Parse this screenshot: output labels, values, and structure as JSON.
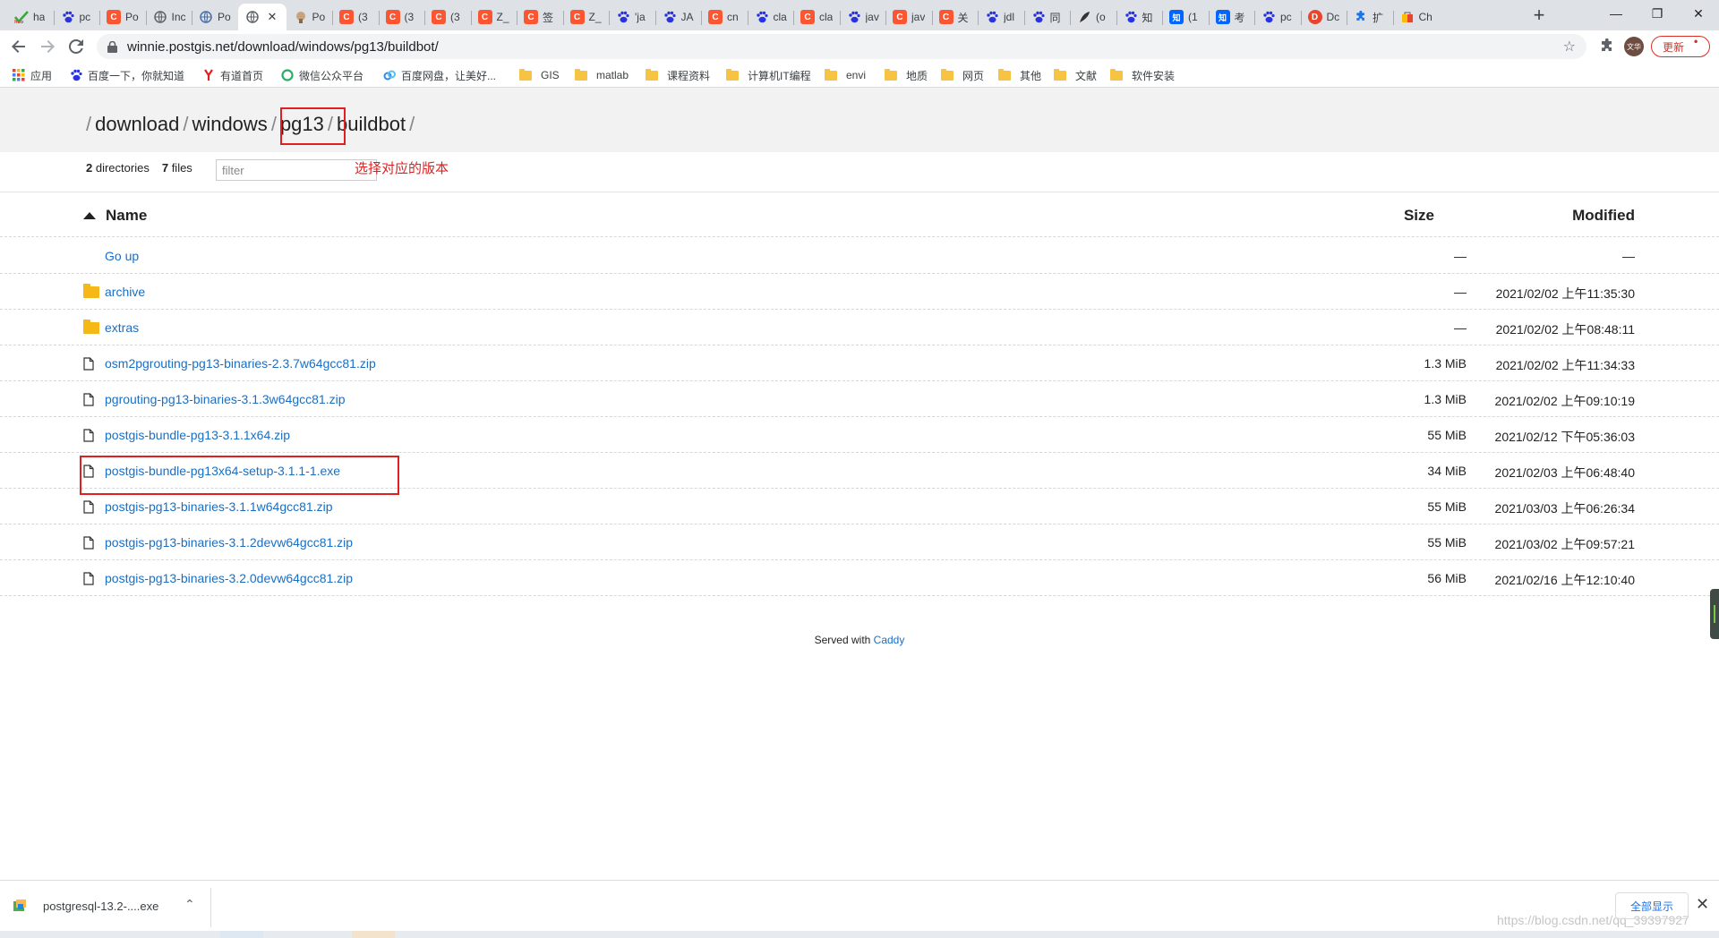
{
  "browser": {
    "tabs": [
      {
        "label": "ha",
        "favicon": "hao123-icon",
        "color": "#3aa83a"
      },
      {
        "label": "pc",
        "favicon": "baidu-paw-icon",
        "color": "#2932e1"
      },
      {
        "label": "Po",
        "favicon": "csdn-icon",
        "color": "#fc5531"
      },
      {
        "label": "Inc",
        "favicon": "globe-icon",
        "color": "#5f6368"
      },
      {
        "label": "Po",
        "favicon": "globe-icon",
        "color": "#4a6fa5"
      },
      {
        "label": "",
        "favicon": "globe-icon",
        "color": "#5f6368",
        "active": true,
        "close": "✕"
      },
      {
        "label": "Po",
        "favicon": "elephant-icon",
        "color": "#b07b4f"
      },
      {
        "label": "(3",
        "favicon": "csdn-icon",
        "color": "#fc5531"
      },
      {
        "label": "(3",
        "favicon": "csdn-icon",
        "color": "#fc5531"
      },
      {
        "label": "(3",
        "favicon": "csdn-icon",
        "color": "#fc5531"
      },
      {
        "label": "Z_",
        "favicon": "csdn-icon",
        "color": "#fc5531"
      },
      {
        "label": "签",
        "favicon": "csdn-icon",
        "color": "#fc5531"
      },
      {
        "label": "Z_",
        "favicon": "csdn-icon",
        "color": "#fc5531"
      },
      {
        "label": "'ja",
        "favicon": "baidu-paw-icon",
        "color": "#2932e1"
      },
      {
        "label": "JA",
        "favicon": "baidu-paw-icon",
        "color": "#2932e1"
      },
      {
        "label": "cn",
        "favicon": "csdn-icon",
        "color": "#fc5531"
      },
      {
        "label": "cla",
        "favicon": "baidu-paw-icon",
        "color": "#2932e1"
      },
      {
        "label": "cla",
        "favicon": "csdn-icon",
        "color": "#fc5531"
      },
      {
        "label": "jav",
        "favicon": "baidu-paw-icon",
        "color": "#2932e1"
      },
      {
        "label": "jav",
        "favicon": "csdn-icon",
        "color": "#fc5531"
      },
      {
        "label": "关",
        "favicon": "csdn-icon",
        "color": "#fc5531"
      },
      {
        "label": "jdl",
        "favicon": "baidu-paw-icon",
        "color": "#2932e1"
      },
      {
        "label": "同",
        "favicon": "baidu-paw-icon",
        "color": "#2932e1"
      },
      {
        "label": "(o",
        "favicon": "feather-icon",
        "color": "#333333"
      },
      {
        "label": "知",
        "favicon": "baidu-paw-icon",
        "color": "#2932e1"
      },
      {
        "label": "(1",
        "favicon": "zhihu-icon",
        "color": "#0066ff"
      },
      {
        "label": "考",
        "favicon": "zhihu-icon",
        "color": "#0066ff"
      },
      {
        "label": "pc",
        "favicon": "baidu-paw-icon",
        "color": "#2932e1"
      },
      {
        "label": "Dc",
        "favicon": "doc-icon",
        "color": "#e8452c"
      },
      {
        "label": "扩",
        "favicon": "puzzle-icon",
        "color": "#1a73e8"
      },
      {
        "label": "Ch",
        "favicon": "chrome-store-icon",
        "color": "#e8452c"
      }
    ],
    "new_tab": "+",
    "window_controls": {
      "minimize": "—",
      "maximize": "❐",
      "close": "✕"
    },
    "url": "winnie.postgis.net/download/windows/pg13/buildbot/",
    "avatar_text": "文华",
    "update_label": "更新",
    "bookmarks": [
      {
        "label": "应用",
        "icon": "apps-grid-icon"
      },
      {
        "label": "百度一下，你就知道",
        "icon": "baidu-paw-icon"
      },
      {
        "label": "有道首页",
        "icon": "youdao-icon"
      },
      {
        "label": "微信公众平台",
        "icon": "wechat-icon"
      },
      {
        "label": "百度网盘，让美好...",
        "icon": "baidu-pan-icon"
      },
      {
        "label": "GIS",
        "icon": "folder-icon"
      },
      {
        "label": "matlab",
        "icon": "folder-icon"
      },
      {
        "label": "课程资料",
        "icon": "folder-icon"
      },
      {
        "label": "计算机IT编程",
        "icon": "folder-icon"
      },
      {
        "label": "envi",
        "icon": "folder-icon"
      },
      {
        "label": "地质",
        "icon": "folder-icon"
      },
      {
        "label": "网页",
        "icon": "folder-icon"
      },
      {
        "label": "其他",
        "icon": "folder-icon"
      },
      {
        "label": "文献",
        "icon": "folder-icon"
      },
      {
        "label": "软件安装",
        "icon": "folder-icon"
      }
    ]
  },
  "listing": {
    "breadcrumbs": [
      "download",
      "windows",
      "pg13",
      "buildbot"
    ],
    "separator": "/",
    "summary": {
      "dirs_count": "2",
      "dirs_label": "directories",
      "files_count": "7",
      "files_label": "files"
    },
    "filter_placeholder": "filter",
    "annotation": "选择对应的版本",
    "headers": {
      "name": "Name",
      "size": "Size",
      "modified": "Modified"
    },
    "rows": [
      {
        "name": "Go up",
        "type": "up",
        "size": "—",
        "modified": "—"
      },
      {
        "name": "archive",
        "type": "folder",
        "size": "—",
        "modified": "2021/02/02 上午11:35:30"
      },
      {
        "name": "extras",
        "type": "folder",
        "size": "—",
        "modified": "2021/02/02 上午08:48:11"
      },
      {
        "name": "osm2pgrouting-pg13-binaries-2.3.7w64gcc81.zip",
        "type": "file",
        "size": "1.3 MiB",
        "modified": "2021/02/02 上午11:34:33"
      },
      {
        "name": "pgrouting-pg13-binaries-3.1.3w64gcc81.zip",
        "type": "file",
        "size": "1.3 MiB",
        "modified": "2021/02/02 上午09:10:19"
      },
      {
        "name": "postgis-bundle-pg13-3.1.1x64.zip",
        "type": "file",
        "size": "55 MiB",
        "modified": "2021/02/12 下午05:36:03"
      },
      {
        "name": "postgis-bundle-pg13x64-setup-3.1.1-1.exe",
        "type": "file",
        "size": "34 MiB",
        "modified": "2021/02/03 上午06:48:40"
      },
      {
        "name": "postgis-pg13-binaries-3.1.1w64gcc81.zip",
        "type": "file",
        "size": "55 MiB",
        "modified": "2021/03/03 上午06:26:34"
      },
      {
        "name": "postgis-pg13-binaries-3.1.2devw64gcc81.zip",
        "type": "file",
        "size": "55 MiB",
        "modified": "2021/03/02 上午09:57:21"
      },
      {
        "name": "postgis-pg13-binaries-3.2.0devw64gcc81.zip",
        "type": "file",
        "size": "56 MiB",
        "modified": "2021/02/16 上午12:10:40"
      }
    ],
    "footer": {
      "text": "Served with",
      "link": "Caddy"
    },
    "colors": {
      "link": "#1a6fc4",
      "highlight": "#e02020",
      "folder": "#f6b817"
    }
  },
  "downloads": {
    "item": "postgresql-13.2-....exe",
    "chevron": "⌃",
    "show_all": "全部显示",
    "close": "✕",
    "watermark": "https://blog.csdn.net/qq_39397927"
  }
}
